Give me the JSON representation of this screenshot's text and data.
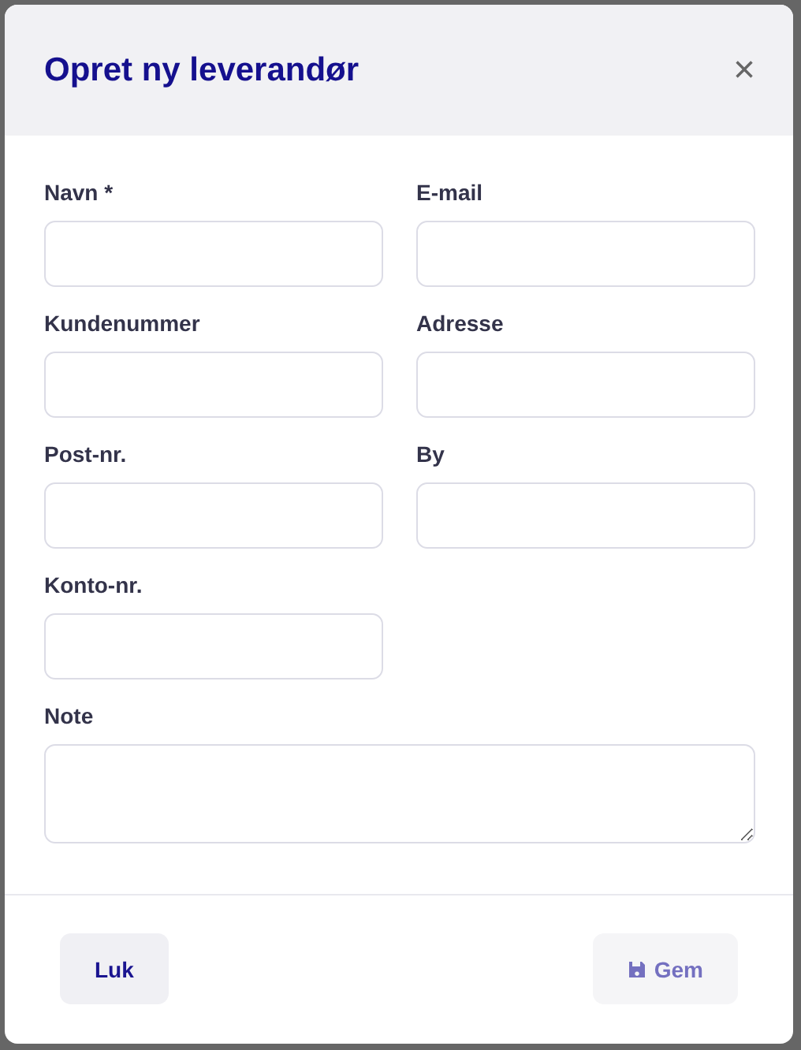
{
  "dialog": {
    "title": "Opret ny leverandør",
    "close": "×"
  },
  "fields": [
    {
      "kind": "input",
      "label": "Navn *"
    },
    {
      "kind": "input",
      "label": "E-mail"
    },
    {
      "kind": "input",
      "label": "Kundenummer"
    },
    {
      "kind": "input",
      "label": "Adresse"
    },
    {
      "kind": "input",
      "label": "Post-nr."
    },
    {
      "kind": "input",
      "label": "By"
    },
    {
      "kind": "input",
      "label": "Konto-nr."
    },
    {
      "kind": "textarea",
      "label": "Note"
    }
  ],
  "buttons": [
    {
      "label": "Luk",
      "icon": false,
      "disabled": false
    },
    {
      "label": "Gem",
      "icon": true,
      "disabled": true
    }
  ]
}
